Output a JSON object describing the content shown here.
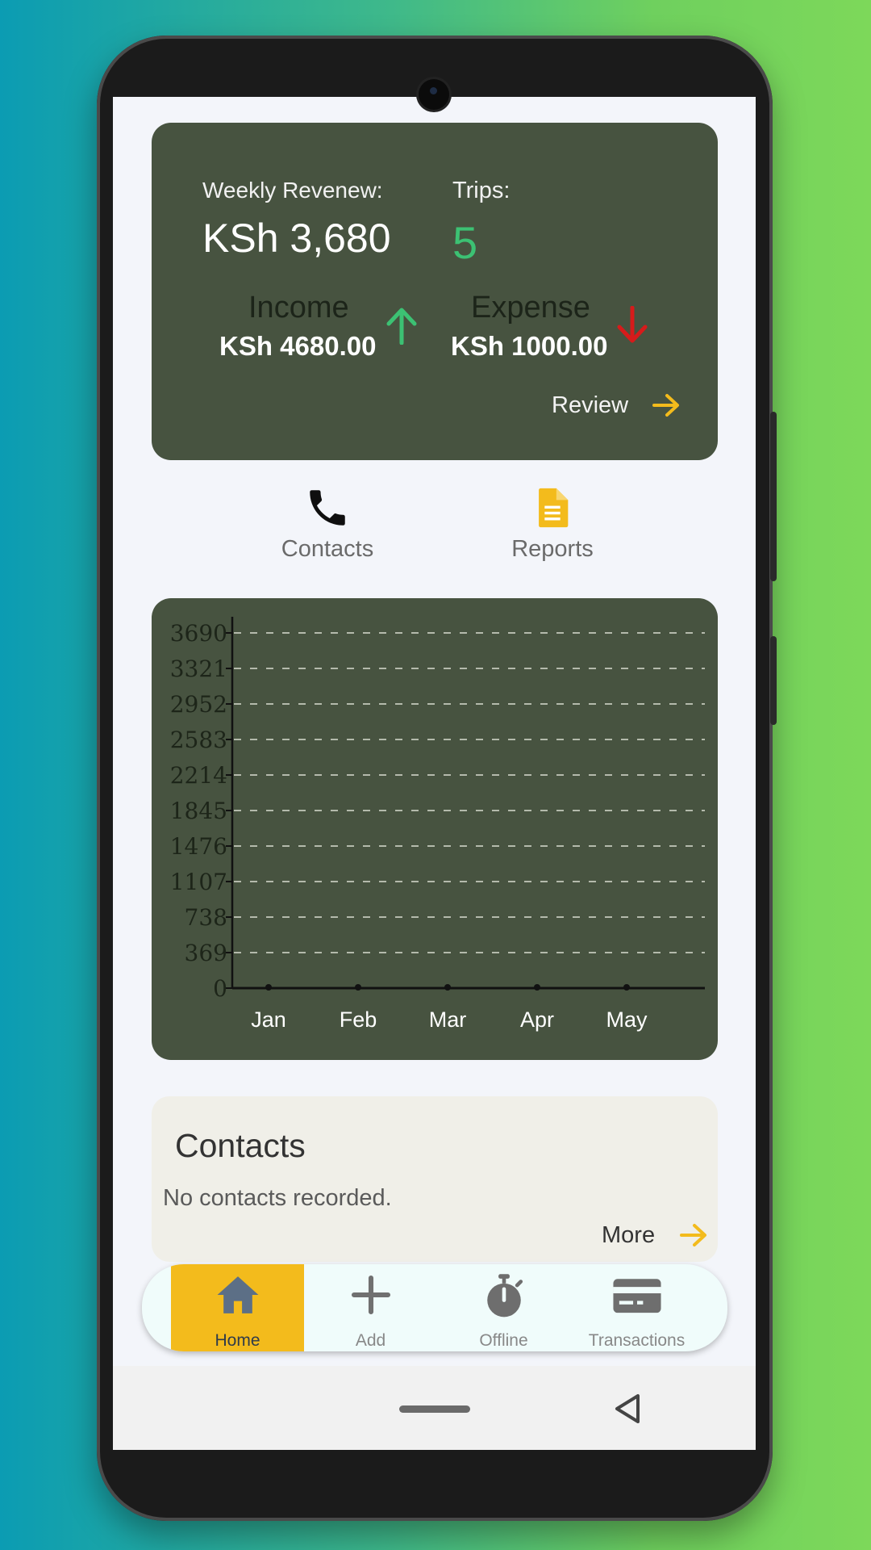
{
  "summary": {
    "weekly_label": "Weekly Revenew:",
    "weekly_value": "KSh 3,680",
    "trips_label": "Trips:",
    "trips_value": "5",
    "income_label": "Income",
    "income_value": "KSh 4680.00",
    "expense_label": "Expense",
    "expense_value": "KSh 1000.00",
    "review_label": "Review",
    "income_arrow_color": "#3cc173",
    "expense_arrow_color": "#d61b1b",
    "review_arrow_color": "#f3bb1c"
  },
  "quick_actions": [
    {
      "label": "Contacts",
      "icon": "phone-icon"
    },
    {
      "label": "Reports",
      "icon": "document-icon",
      "color": "#f3bb1c"
    }
  ],
  "chart_data": {
    "type": "line",
    "categories": [
      "Jan",
      "Feb",
      "Mar",
      "Apr",
      "May"
    ],
    "series": [
      {
        "values": [
          0,
          0,
          0,
          0,
          0
        ]
      }
    ],
    "yticks": [
      "3690",
      "3321",
      "2952",
      "2583",
      "2214",
      "1845",
      "1476",
      "1107",
      "738",
      "369",
      "0"
    ],
    "ylim": [
      0,
      3690
    ],
    "grid": true,
    "title": "",
    "xlabel": "",
    "ylabel": ""
  },
  "contacts": {
    "title": "Contacts",
    "empty_text": "No contacts recorded.",
    "more_label": "More"
  },
  "nav": {
    "items": [
      {
        "label": "Home",
        "icon": "home-icon"
      },
      {
        "label": "Add",
        "icon": "plus-icon"
      },
      {
        "label": "Offline",
        "icon": "stopwatch-icon"
      },
      {
        "label": "Transactions",
        "icon": "credit-card-icon"
      }
    ],
    "active": "Home",
    "active_color": "#f3bb1c"
  }
}
